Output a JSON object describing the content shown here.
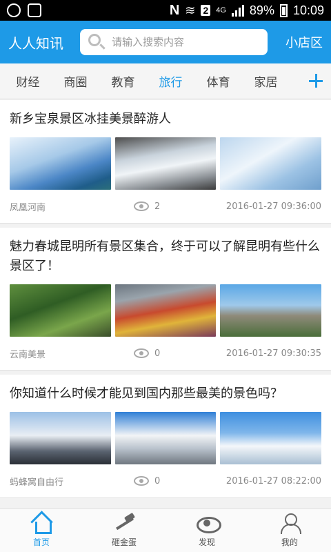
{
  "statusbar": {
    "nfc": "N",
    "sim": "2",
    "network": "4G",
    "battery": "89%",
    "time": "10:09"
  },
  "header": {
    "title": "人人知讯",
    "search_placeholder": "请输入搜索内容",
    "store_label": "小店区"
  },
  "tabs": [
    {
      "label": "财经",
      "active": false
    },
    {
      "label": "商圈",
      "active": false
    },
    {
      "label": "教育",
      "active": false
    },
    {
      "label": "旅行",
      "active": true
    },
    {
      "label": "体育",
      "active": false
    },
    {
      "label": "家居",
      "active": false
    }
  ],
  "articles": [
    {
      "title": "新乡宝泉景区冰挂美景醉游人",
      "source": "凤凰河南",
      "views": "2",
      "time": "2016-01-27 09:36:00",
      "images": [
        "frozen-waterfall-pool",
        "icicles-cliff",
        "snowy-ice-stream"
      ]
    },
    {
      "title": "魅力春城昆明所有景区集合，终于可以了解昆明有些什么景区了！",
      "source": "云南美景",
      "views": "0",
      "time": "2016-01-27 09:30:35",
      "images": [
        "green-forest-trees",
        "flower-garden-greenhouse",
        "stone-forest-peaks"
      ]
    },
    {
      "title": "你知道什么时候才能见到国内那些最美的景色吗？",
      "source": "蚂蜂窝自由行",
      "views": "0",
      "time": "2016-01-27 08:22:00",
      "images": [
        "snow-mountain-range",
        "snowy-peaks-clouds",
        "snow-mountain-peak"
      ]
    }
  ],
  "bottom_nav": [
    {
      "label": "首页",
      "icon": "home-icon",
      "active": true
    },
    {
      "label": "砸金蛋",
      "icon": "hammer-icon",
      "active": false
    },
    {
      "label": "发现",
      "icon": "eye-icon",
      "active": false
    },
    {
      "label": "我的",
      "icon": "user-icon",
      "active": false
    }
  ],
  "colors": {
    "accent": "#1e9ae7",
    "text": "#222222",
    "meta": "#888888"
  }
}
